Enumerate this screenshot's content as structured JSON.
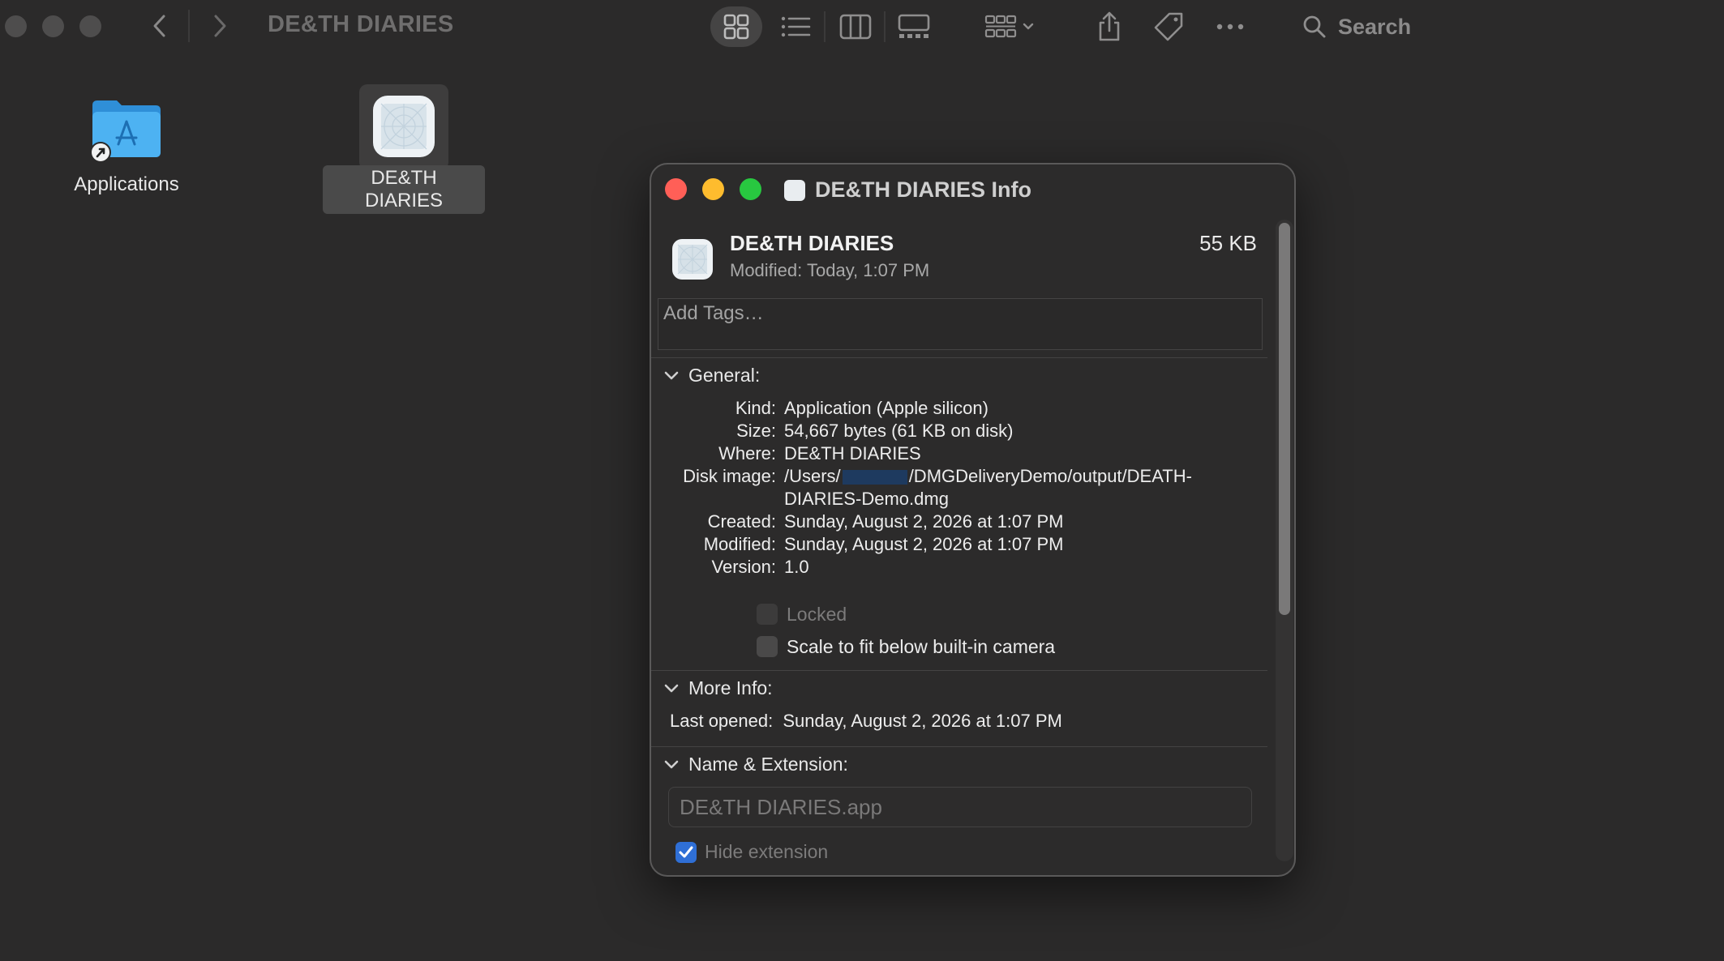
{
  "finder": {
    "title": "DE&TH DIARIES",
    "search_label": "Search"
  },
  "desktop": {
    "items": [
      {
        "label": "Applications"
      },
      {
        "label": "DE&TH DIARIES"
      }
    ]
  },
  "info_window": {
    "title": "DE&TH DIARIES Info",
    "name": "DE&TH DIARIES",
    "modified": "Modified:  Today, 1:07 PM",
    "size": "55 KB",
    "tags_placeholder": "Add Tags…",
    "general": {
      "header": "General:",
      "kind_key": "Kind:",
      "kind_val": "Application (Apple silicon)",
      "size_key": "Size:",
      "size_val": "54,667 bytes (61 KB on disk)",
      "where_key": "Where:",
      "where_val": "DE&TH DIARIES",
      "disk_key": "Disk image:",
      "disk_val_a": "/Users/",
      "disk_val_b": "/DMGDeliveryDemo/output/DEATH-",
      "disk_val_c": "DIARIES-Demo.dmg",
      "created_key": "Created:",
      "created_val": "Sunday, August 2, 2026 at 1:07 PM",
      "modified_key": "Modified:",
      "modified_val": "Sunday, August 2, 2026 at 1:07 PM",
      "version_key": "Version:",
      "version_val": "1.0",
      "locked_label": "Locked",
      "scale_label": "Scale to fit below built-in camera"
    },
    "more_info": {
      "header": "More Info:",
      "last_opened_key": "Last opened:",
      "last_opened_val": "Sunday, August 2, 2026 at 1:07 PM"
    },
    "name_ext": {
      "header": "Name & Extension:",
      "field_value": "DE&TH DIARIES.app",
      "hide_ext_label": "Hide extension",
      "hide_ext_checked": true
    }
  },
  "colors": {
    "close": "#ff5f57",
    "minimize": "#febc2e",
    "zoom": "#28c840",
    "folder": "#3fa9f5",
    "checkbox_on": "#2f6fd6"
  }
}
